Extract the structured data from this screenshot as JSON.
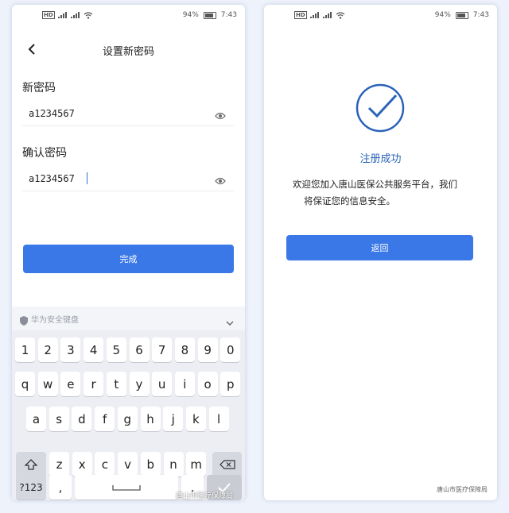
{
  "status_bar": {
    "battery": "94%",
    "time": "7:43",
    "sim_label": "HD"
  },
  "left_screen": {
    "title": "设置新密码",
    "new_password_label": "新密码",
    "new_password_value": "a1234567",
    "confirm_password_label": "确认密码",
    "confirm_password_value": "a1234567",
    "submit_label": "完成"
  },
  "keyboard": {
    "bar_text": "华为安全键盘",
    "row_numbers": [
      "1",
      "2",
      "3",
      "4",
      "5",
      "6",
      "7",
      "8",
      "9",
      "0"
    ],
    "row_q": [
      "q",
      "w",
      "e",
      "r",
      "t",
      "y",
      "u",
      "i",
      "o",
      "p"
    ],
    "row_a": [
      "a",
      "s",
      "d",
      "f",
      "g",
      "h",
      "j",
      "k",
      "l"
    ],
    "row_z": [
      "z",
      "x",
      "c",
      "v",
      "b",
      "n",
      "m"
    ],
    "symbols_label": "?123",
    "comma_label": ",",
    "space_label": "",
    "period_label": "."
  },
  "right_screen": {
    "success_title": "注册成功",
    "success_message_line1": "欢迎您加入唐山医保公共服务平台，我们",
    "success_message_line2": "将保证您的信息安全。",
    "return_label": "返回"
  },
  "watermark": "唐山市医疗保障局",
  "colors": {
    "accent": "#3b78e7",
    "success_ring": "#2b63b8"
  }
}
